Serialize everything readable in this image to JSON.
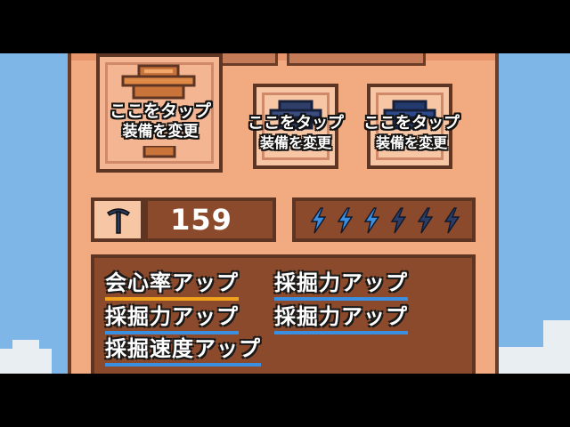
{
  "equipment": {
    "slots": [
      {
        "tap_text": "ここをタップ",
        "equip_text": "装備を変更",
        "helmet": "orange-helmet"
      },
      {
        "tap_text": "ここをタップ",
        "equip_text": "装備を変更",
        "helmet": "navy-helmet"
      },
      {
        "tap_text": "ここをタップ",
        "equip_text": "装備を変更",
        "helmet": "navy-helmet"
      }
    ]
  },
  "stats": {
    "icon": "pickaxe-icon",
    "mining_power": "159",
    "energy_max": 6,
    "energy_current": 3,
    "energy_color": "#3b8fe0",
    "energy_empty_color": "#2c3e66"
  },
  "skills": [
    {
      "label": "会心率アップ",
      "underline": "#f1a21c"
    },
    {
      "label": "採掘力アップ",
      "underline": "#3b8fe0"
    },
    {
      "label": "採掘力アップ",
      "underline": "#3b8fe0"
    },
    {
      "label": "採掘力アップ",
      "underline": "#3b8fe0"
    },
    {
      "label": "採掘速度アップ",
      "underline": "#3b8fe0"
    }
  ]
}
